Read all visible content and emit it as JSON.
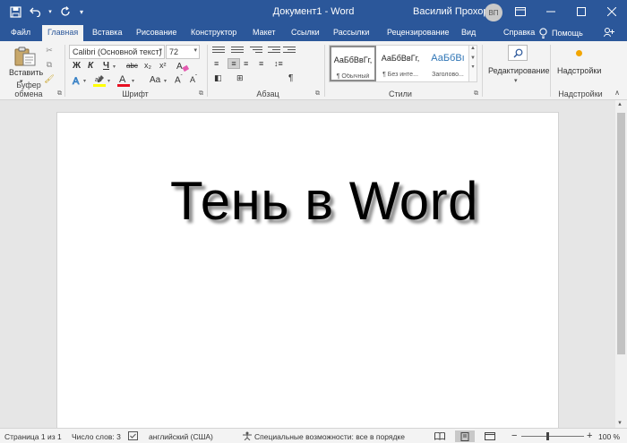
{
  "titlebar": {
    "doc_title": "Документ1 - Word",
    "user_name": "Василий Прохоров",
    "user_initials": "ВП",
    "icons": [
      "save-icon",
      "undo-icon",
      "redo-icon",
      "ribbon-display-icon",
      "minimize-icon",
      "maximize-icon",
      "close-icon"
    ]
  },
  "tabs": [
    "Файл",
    "Главная",
    "Вставка",
    "Рисование",
    "Конструктор",
    "Макет",
    "Ссылки",
    "Рассылки",
    "Рецензирование",
    "Вид",
    "Справка",
    "Помощь"
  ],
  "ribbon": {
    "clipboard": {
      "paste_label": "Вставить",
      "group_label": "Буфер обмена"
    },
    "font": {
      "font_name": "Calibri (Основной текст)",
      "font_size": "72",
      "bold": "Ж",
      "italic": "К",
      "underline": "Ч",
      "strike": "abc",
      "subscript": "x₂",
      "superscript": "x²",
      "group_label": "Шрифт"
    },
    "paragraph": {
      "pilcrow": "¶",
      "group_label": "Абзац"
    },
    "styles": {
      "items": [
        {
          "sample": "АаБбВвГг,",
          "name": "¶ Обычный"
        },
        {
          "sample": "АаБбВвГг,",
          "name": "¶ Без инте..."
        },
        {
          "sample": "АаБбВı",
          "name": "Заголово..."
        }
      ],
      "group_label": "Стили"
    },
    "editing": {
      "label": "Редактирование"
    },
    "addins": {
      "label": "Надстройки",
      "group_label": "Надстройки"
    }
  },
  "document": {
    "text": "Тень в Word"
  },
  "statusbar": {
    "page": "Страница 1 из 1",
    "words": "Число слов: 3",
    "language": "английский (США)",
    "accessibility": "Специальные возможности: все в порядке",
    "zoom": "100 %",
    "zoom_level_percent": 100
  },
  "colors": {
    "brand": "#2b579a",
    "ribbon": "#f3f3f3",
    "highlight": "#ffff00",
    "font_color": "#e81123"
  }
}
